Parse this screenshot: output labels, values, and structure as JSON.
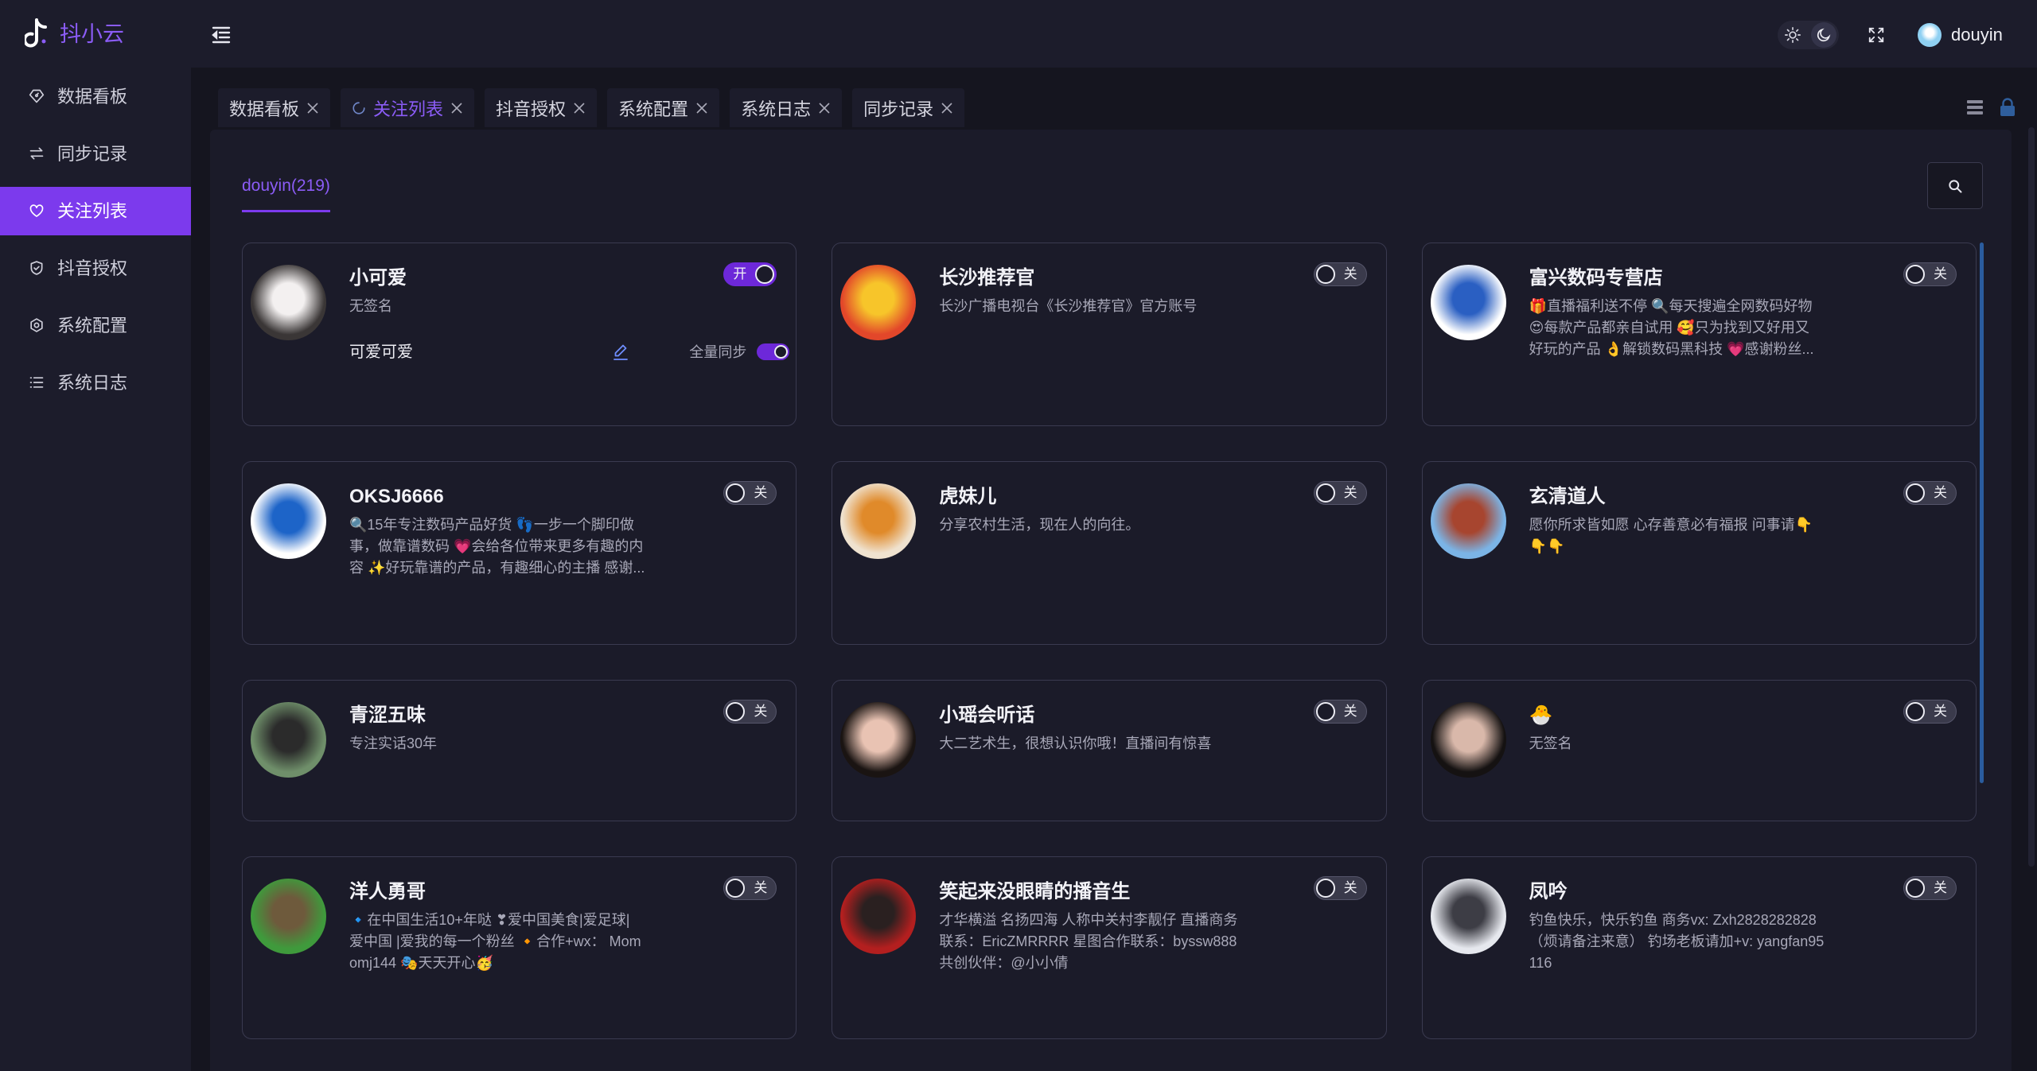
{
  "app": {
    "title": "抖小云"
  },
  "header": {
    "user": "douyin"
  },
  "sidebar": {
    "items": [
      {
        "label": "数据看板",
        "icon": "dashboard-icon",
        "active": false
      },
      {
        "label": "同步记录",
        "icon": "sync-icon",
        "active": false
      },
      {
        "label": "关注列表",
        "icon": "heart-icon",
        "active": true
      },
      {
        "label": "抖音授权",
        "icon": "shield-check-icon",
        "active": false
      },
      {
        "label": "系统配置",
        "icon": "gear-icon",
        "active": false
      },
      {
        "label": "系统日志",
        "icon": "list-icon",
        "active": false
      }
    ]
  },
  "tabs": [
    {
      "label": "数据看板",
      "active": false
    },
    {
      "label": "关注列表",
      "active": true
    },
    {
      "label": "抖音授权",
      "active": false
    },
    {
      "label": "系统配置",
      "active": false
    },
    {
      "label": "系统日志",
      "active": false
    },
    {
      "label": "同步记录",
      "active": false
    }
  ],
  "account_tab": {
    "label": "douyin(219)",
    "active": true
  },
  "cards": [
    {
      "name": "小可爱",
      "desc": [
        "无签名"
      ],
      "on": true,
      "switch_label": "开",
      "remark": "可爱可爱",
      "full_sync_label": "全量同步",
      "full_sync_on": true,
      "avatar": [
        "#f3f0f0",
        "#3a3636"
      ]
    },
    {
      "name": "长沙推荐官",
      "desc": [
        "长沙广播电视台《长沙推荐官》官方账号"
      ],
      "on": false,
      "switch_label": "关",
      "avatar": [
        "#f7c52a",
        "#e2472a"
      ]
    },
    {
      "name": "富兴数码专营店",
      "desc": [
        "🎁直播福利送不停 🔍每天搜遍全网数码好物",
        "😍每款产品都亲自试用 🥰只为找到又好用又",
        "好玩的产品 👌解锁数码黑科技 💗感谢粉丝..."
      ],
      "on": false,
      "switch_label": "关",
      "avatar": [
        "#2a5fc2",
        "#ffffff"
      ]
    },
    {
      "name": "OKSJ6666",
      "desc": [
        "🔍15年专注数码产品好货 👣一步一个脚印做",
        "事，做靠谱数码 💗会给各位带来更多有趣的内",
        "容 ✨好玩靠谱的产品，有趣细心的主播 感谢..."
      ],
      "on": false,
      "switch_label": "关",
      "avatar": [
        "#1d64c8",
        "#ffffff"
      ]
    },
    {
      "name": "虎妹儿",
      "desc": [
        "分享农村生活，现在人的向往。"
      ],
      "on": false,
      "switch_label": "关",
      "avatar": [
        "#e08a2a",
        "#efe2cf"
      ]
    },
    {
      "name": "玄清道人",
      "desc": [
        "愿你所求皆如愿 心存善意必有福报 问事请👇",
        "👇👇"
      ],
      "on": false,
      "switch_label": "关",
      "avatar": [
        "#a7452f",
        "#7bb4e6"
      ]
    },
    {
      "name": "青涩五味",
      "desc": [
        "专注实话30年"
      ],
      "on": false,
      "switch_label": "关",
      "avatar": [
        "#2b2b2b",
        "#6f8f6a"
      ]
    },
    {
      "name": "小瑶会听话",
      "desc": [
        "大二艺术生，很想认识你哦！直播间有惊喜"
      ],
      "on": false,
      "switch_label": "关",
      "avatar": [
        "#e9c3b3",
        "#1a1412"
      ]
    },
    {
      "name": "🐣",
      "desc": [
        "无签名"
      ],
      "on": false,
      "switch_label": "关",
      "avatar": [
        "#d9b8aa",
        "#151212"
      ]
    },
    {
      "name": "洋人勇哥",
      "desc": [
        "🔹在中国生活10+年哒 ❣爱中国美食|爱足球|",
        "爱中国 |爱我的每一个粉丝 🔸合作+wx：  Mom",
        "omj144 🎭天天开心🥳"
      ],
      "on": false,
      "switch_label": "关",
      "avatar": [
        "#6e5a3c",
        "#3f9a3c"
      ]
    },
    {
      "name": "笑起来没眼睛的播音生",
      "desc": [
        "才华横溢 名扬四海 人称中关村李靓仔 直播商务",
        "联系：EricZMRRRR 星图合作联系：byssw888",
        "共创伙伴：@小小倩"
      ],
      "on": false,
      "switch_label": "关",
      "avatar": [
        "#2a2020",
        "#b31f1f"
      ]
    },
    {
      "name": "凤吟",
      "desc": [
        "钓鱼快乐，快乐钓鱼 商务vx: Zxh2828282828",
        "（烦请备注来意） 钓场老板请加+v: yangfan95",
        "116"
      ],
      "on": false,
      "switch_label": "关",
      "avatar": [
        "#3d3d45",
        "#e6e8ee"
      ]
    }
  ],
  "colors": {
    "accent": "#7c3aed",
    "accent_text": "#8b5cf6",
    "background": "#15151f",
    "surface": "#1b1b29",
    "card_border": "#3a3a50",
    "edit_icon": "#6f8dff"
  }
}
